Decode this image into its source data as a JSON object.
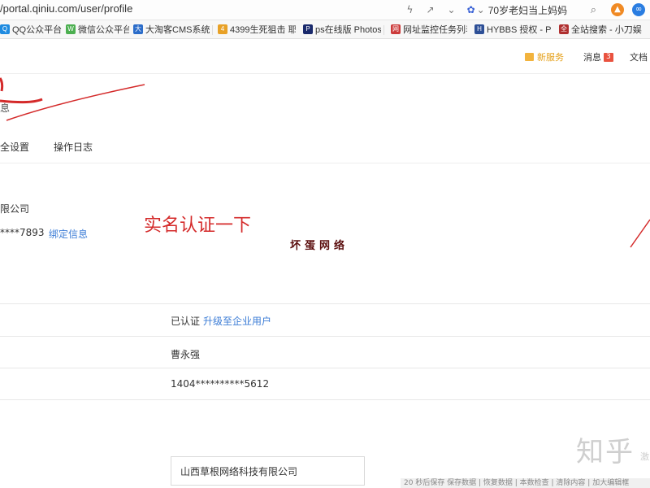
{
  "browser": {
    "url": "/portal.qiniu.com/user/profile",
    "search_text": "70岁老妇当上妈妈",
    "bookmarks": [
      {
        "label": "QQ公众平台",
        "color": "#1f8be0",
        "icon": "Q"
      },
      {
        "label": "微信公众平台",
        "color": "#4caf50",
        "icon": "W"
      },
      {
        "label": "大淘客CMS系统下",
        "color": "#2b6cc9",
        "icon": "大"
      },
      {
        "label": "4399生死狙击 耶",
        "color": "#e8a127",
        "icon": "4"
      },
      {
        "label": "ps在线版 Photos",
        "color": "#1a2a6c",
        "icon": "P"
      },
      {
        "label": "网址监控任务列表",
        "color": "#cc3b3b",
        "icon": "网"
      },
      {
        "label": "HYBBS 授权 - Po",
        "color": "#2d4f96",
        "icon": "H"
      },
      {
        "label": "全站搜索 - 小刀娱",
        "color": "#b03030",
        "icon": "全"
      }
    ]
  },
  "header": {
    "new_feature": "新服务",
    "messages_label": "消息",
    "messages_count": "3",
    "docs_label": "文档"
  },
  "page": {
    "subtitle_fragment": "息",
    "tabs": [
      "全设置",
      "操作日志"
    ],
    "company_fragment": "限公司",
    "phone_fragment": "****7893",
    "bind_link": "绑定信息",
    "annotation": "实名认证一下",
    "watermark": "坏蛋网络",
    "rows": {
      "status": "已认证",
      "upgrade_link": "升级至企业用户",
      "name": "曹永强",
      "id_number": "1404**********5612"
    },
    "company_input_value": "山西草根网络科技有限公司"
  },
  "overlay": {
    "zhihu_logo": "知乎",
    "zhihu_side": "激",
    "footer_text": "20 秒后保存 保存数据 | 恢复数据 | 本数检查 | 清除内容 | 加大编辑框"
  },
  "colors": {
    "link": "#3b7cd6",
    "annotation_red": "#d42a2a",
    "badge_red": "#e9523f",
    "accent_orange": "#e5a019"
  }
}
